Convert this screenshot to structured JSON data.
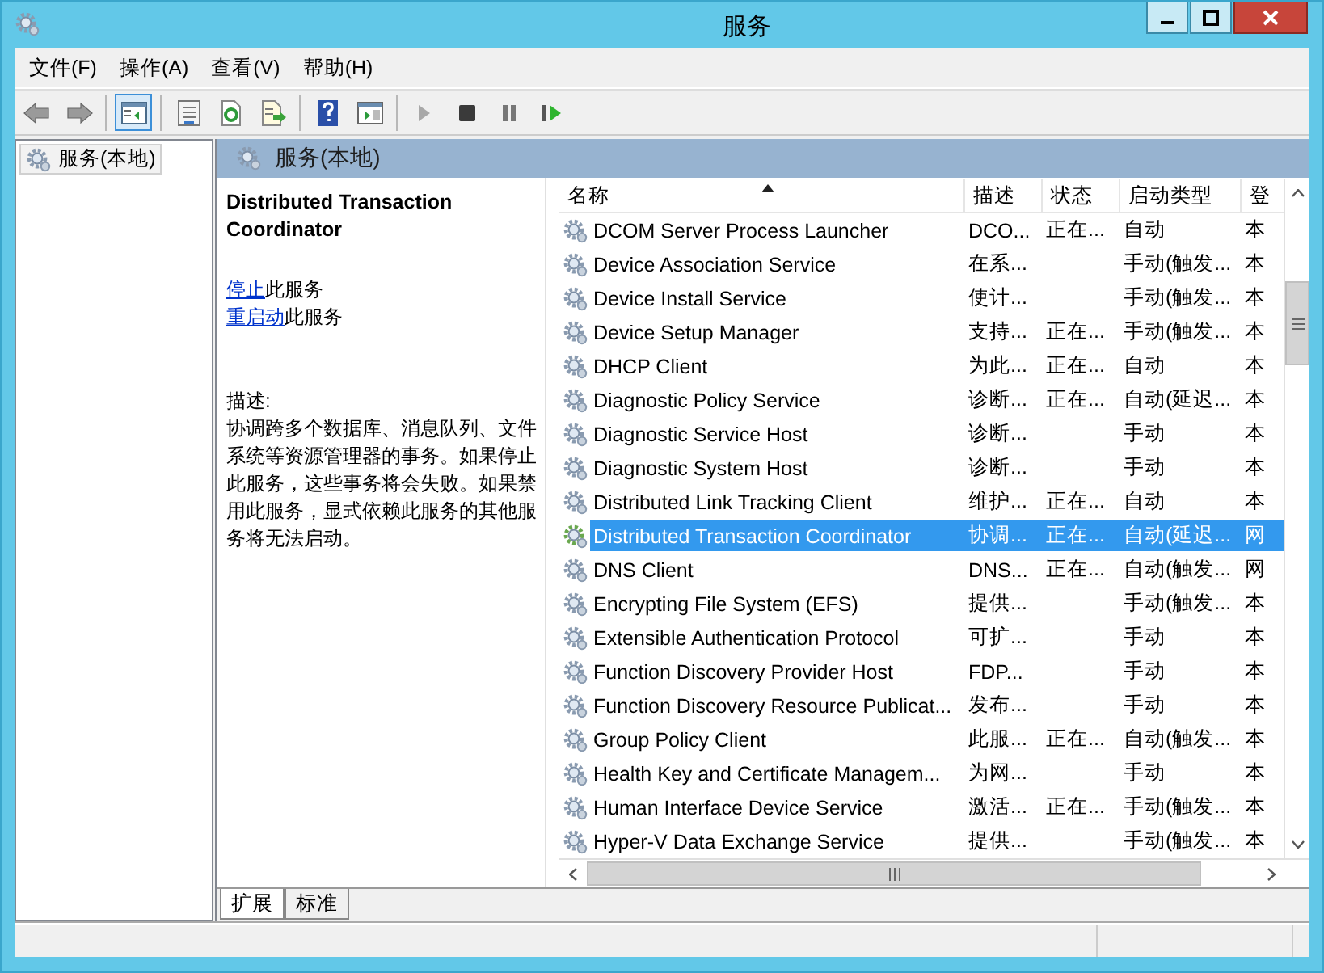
{
  "window": {
    "title": "服务"
  },
  "menu": [
    {
      "label": "文件(F)"
    },
    {
      "label": "操作(A)"
    },
    {
      "label": "查看(V)"
    },
    {
      "label": "帮助(H)"
    }
  ],
  "toolbar": [
    {
      "kind": "back",
      "disabled": true
    },
    {
      "kind": "forward",
      "disabled": true
    },
    {
      "kind": "sep"
    },
    {
      "kind": "tree",
      "pressed": true
    },
    {
      "kind": "sep"
    },
    {
      "kind": "properties",
      "disabled": false
    },
    {
      "kind": "refresh",
      "disabled": false
    },
    {
      "kind": "export",
      "disabled": false
    },
    {
      "kind": "sep"
    },
    {
      "kind": "help",
      "disabled": false
    },
    {
      "kind": "view",
      "disabled": false
    },
    {
      "kind": "sep"
    },
    {
      "kind": "start",
      "disabled": true
    },
    {
      "kind": "stop",
      "disabled": false
    },
    {
      "kind": "pause",
      "disabled": false
    },
    {
      "kind": "restart",
      "disabled": false
    }
  ],
  "tree": [
    {
      "label": "服务(本地)",
      "selected": true
    }
  ],
  "pane_header": "服务(本地)",
  "details": {
    "title": "Distributed Transaction Coordinator",
    "actions": [
      {
        "link": "停止",
        "text": "此服务"
      },
      {
        "link": "重启动",
        "text": "此服务"
      }
    ],
    "description_label": "描述:",
    "description": "协调跨多个数据库、消息队列、文件系统等资源管理器的事务。如果停止此服务，这些事务将会失败。如果禁用此服务，显式依赖此服务的其他服务将无法启动。"
  },
  "table": {
    "columns": [
      {
        "label": "名称",
        "sorted": true
      },
      {
        "label": "描述",
        "sorted": false
      },
      {
        "label": "状态",
        "sorted": false
      },
      {
        "label": "启动类型",
        "sorted": false
      },
      {
        "label": "登",
        "sorted": false
      }
    ],
    "rows": [
      {
        "name": "DCOM Server Process Launcher",
        "description": "DCO...",
        "status": "正在...",
        "startup": "自动",
        "logon": "本",
        "selected": false
      },
      {
        "name": "Device Association Service",
        "description": "在系...",
        "status": "",
        "startup": "手动(触发...",
        "logon": "本",
        "selected": false
      },
      {
        "name": "Device Install Service",
        "description": "使计...",
        "status": "",
        "startup": "手动(触发...",
        "logon": "本",
        "selected": false
      },
      {
        "name": "Device Setup Manager",
        "description": "支持...",
        "status": "正在...",
        "startup": "手动(触发...",
        "logon": "本",
        "selected": false
      },
      {
        "name": "DHCP Client",
        "description": "为此...",
        "status": "正在...",
        "startup": "自动",
        "logon": "本",
        "selected": false
      },
      {
        "name": "Diagnostic Policy Service",
        "description": "诊断...",
        "status": "正在...",
        "startup": "自动(延迟...",
        "logon": "本",
        "selected": false
      },
      {
        "name": "Diagnostic Service Host",
        "description": "诊断...",
        "status": "",
        "startup": "手动",
        "logon": "本",
        "selected": false
      },
      {
        "name": "Diagnostic System Host",
        "description": "诊断...",
        "status": "",
        "startup": "手动",
        "logon": "本",
        "selected": false
      },
      {
        "name": "Distributed Link Tracking Client",
        "description": "维护...",
        "status": "正在...",
        "startup": "自动",
        "logon": "本",
        "selected": false
      },
      {
        "name": "Distributed Transaction Coordinator",
        "description": "协调...",
        "status": "正在...",
        "startup": "自动(延迟...",
        "logon": "网",
        "selected": true
      },
      {
        "name": "DNS Client",
        "description": "DNS...",
        "status": "正在...",
        "startup": "自动(触发...",
        "logon": "网",
        "selected": false
      },
      {
        "name": "Encrypting File System (EFS)",
        "description": "提供...",
        "status": "",
        "startup": "手动(触发...",
        "logon": "本",
        "selected": false
      },
      {
        "name": "Extensible Authentication Protocol",
        "description": "可扩...",
        "status": "",
        "startup": "手动",
        "logon": "本",
        "selected": false
      },
      {
        "name": "Function Discovery Provider Host",
        "description": "FDP...",
        "status": "",
        "startup": "手动",
        "logon": "本",
        "selected": false
      },
      {
        "name": "Function Discovery Resource Publicat...",
        "description": "发布...",
        "status": "",
        "startup": "手动",
        "logon": "本",
        "selected": false
      },
      {
        "name": "Group Policy Client",
        "description": "此服...",
        "status": "正在...",
        "startup": "自动(触发...",
        "logon": "本",
        "selected": false
      },
      {
        "name": "Health Key and Certificate Managem...",
        "description": "为网...",
        "status": "",
        "startup": "手动",
        "logon": "本",
        "selected": false
      },
      {
        "name": "Human Interface Device Service",
        "description": "激活...",
        "status": "正在...",
        "startup": "手动(触发...",
        "logon": "本",
        "selected": false
      },
      {
        "name": "Hyper-V Data Exchange Service",
        "description": "提供...",
        "status": "",
        "startup": "手动(触发...",
        "logon": "本",
        "selected": false
      }
    ]
  },
  "tabs": [
    {
      "label": "扩展",
      "selected": true
    },
    {
      "label": "标准",
      "selected": false
    }
  ]
}
